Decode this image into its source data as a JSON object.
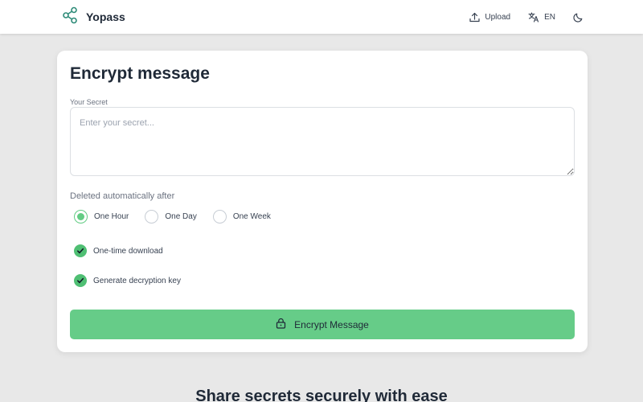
{
  "navbar": {
    "brand": "Yopass",
    "upload_label": "Upload",
    "language_label": "EN"
  },
  "form": {
    "title": "Encrypt message",
    "secret_label": "Your Secret",
    "secret_placeholder": "Enter your secret...",
    "secret_value": "",
    "expiry_label": "Deleted automatically after",
    "expiry_options": [
      {
        "label": "One Hour",
        "checked": true
      },
      {
        "label": "One Day",
        "checked": false
      },
      {
        "label": "One Week",
        "checked": false
      }
    ],
    "one_time_label": "One-time download",
    "one_time_checked": true,
    "generate_key_label": "Generate decryption key",
    "generate_key_checked": true,
    "submit_label": "Encrypt Message"
  },
  "section": {
    "heading": "Share secrets securely with ease"
  },
  "colors": {
    "accent": "#66cc88",
    "check": "#4fbf73",
    "background": "#e8e8e8",
    "logo": "#2e8b78"
  },
  "icons": {
    "brand": "share-nodes-icon",
    "upload": "upload-icon",
    "language": "translate-icon",
    "theme": "moon-icon",
    "submit": "lock-icon"
  }
}
